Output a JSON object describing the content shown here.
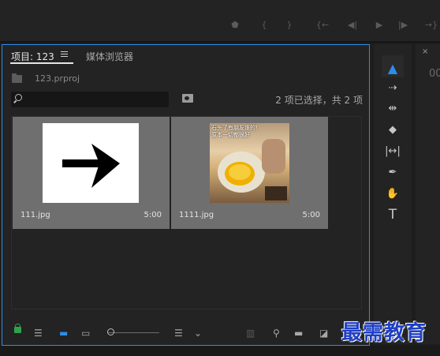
{
  "project_panel": {
    "tabs": [
      {
        "label": "项目: 123",
        "active": true
      },
      {
        "label": "媒体浏览器",
        "active": false
      }
    ],
    "project_file": "123.prproj",
    "search_placeholder": "",
    "selection_status": "2 项已选择，共 2 项",
    "items": [
      {
        "name": "111.jpg",
        "duration": "5:00",
        "thumbnail": "arrow-right"
      },
      {
        "name": "1111.jpg",
        "duration": "5:00",
        "thumbnail": "photo-cup",
        "thumb_caption": "石头了有朋友谁的!\n原本一切都很好"
      }
    ]
  },
  "tools": [
    "selection-tool",
    "track-select-tool",
    "ripple-edit-tool",
    "razor-tool",
    "slip-tool",
    "pen-tool",
    "hand-tool",
    "type-tool"
  ],
  "right_panel": {
    "close": "×",
    "timecode": "00"
  },
  "watermark": "最需教育",
  "colors": {
    "accent": "#2d8ceb",
    "lock": "#2fa14a",
    "watermark": "#1f3fc4"
  }
}
